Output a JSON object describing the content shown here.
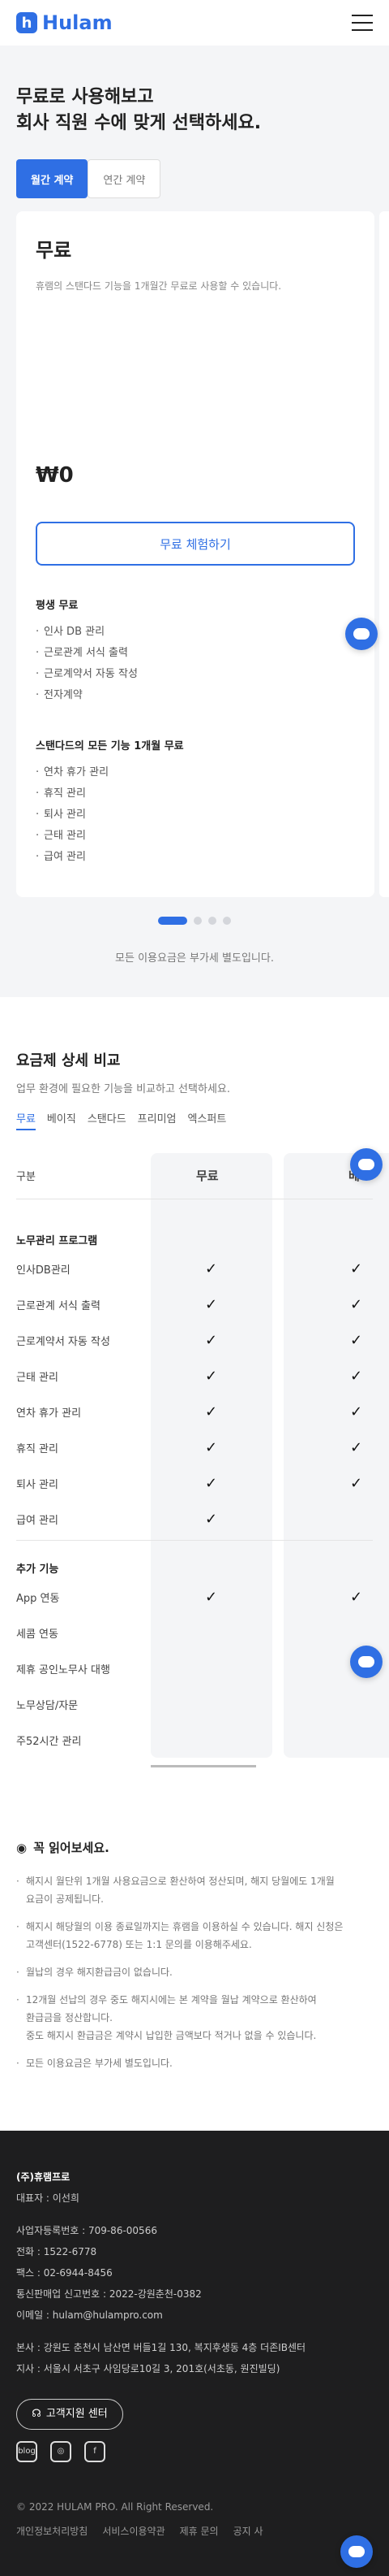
{
  "brand": {
    "logo_letter": "h",
    "name": "Hulam"
  },
  "hero": {
    "title_line1": "무료로 사용해보고",
    "title_line2": "회사 직원 수에 맞게 선택하세요.",
    "toggle_monthly": "월간 계약",
    "toggle_yearly": "연간 계약"
  },
  "plan": {
    "name": "무료",
    "description": "휴램의 스탠다드 기능을 1개월간 무료로 사용할 수 있습니다.",
    "price": "₩0",
    "cta": "무료 체험하기",
    "lifetime_title": "평생 무료",
    "lifetime_features": [
      "인사 DB 관리",
      "근로관계 서식 출력",
      "근로계약서 자동 작성",
      "전자계약"
    ],
    "trial_title": "스탠다드의 모든 기능 1개월 무료",
    "trial_features": [
      "연차 휴가 관리",
      "휴직 관리",
      "퇴사 관리",
      "근태 관리",
      "급여 관리"
    ]
  },
  "vat_note": "모든 이용요금은 부가세 별도입니다.",
  "compare": {
    "title": "요금제 상세 비교",
    "subtitle": "업무 환경에 필요한 기능을 비교하고 선택하세요.",
    "tabs": [
      "무료",
      "베이직",
      "스탠다드",
      "프리미엄",
      "엑스퍼트"
    ],
    "header_label": "구분",
    "col_free": "무료",
    "col_basic": "베",
    "check": "✓",
    "group1_title": "노무관리 프로그램",
    "group1_rows": [
      {
        "label": "인사DB관리",
        "free": true,
        "basic": true
      },
      {
        "label": "근로관계 서식 출력",
        "free": true,
        "basic": true
      },
      {
        "label": "근로계약서 자동 작성",
        "free": true,
        "basic": true
      },
      {
        "label": "근태 관리",
        "free": true,
        "basic": true
      },
      {
        "label": "연차 휴가 관리",
        "free": true,
        "basic": true
      },
      {
        "label": "휴직 관리",
        "free": true,
        "basic": true
      },
      {
        "label": "퇴사 관리",
        "free": true,
        "basic": true
      },
      {
        "label": "급여 관리",
        "free": true,
        "basic": false
      }
    ],
    "group2_title": "추가 기능",
    "group2_rows": [
      {
        "label": "App 연동",
        "free": true,
        "basic": true
      },
      {
        "label": "세콤 연동",
        "free": false,
        "basic": false
      },
      {
        "label": "제휴 공인노무사 대행",
        "free": false,
        "basic": false
      },
      {
        "label": "노무상담/자문",
        "free": false,
        "basic": false
      },
      {
        "label": "주52시간 관리",
        "free": false,
        "basic": false
      }
    ]
  },
  "notice": {
    "title": "꼭 읽어보세요.",
    "items": [
      [
        "해지시 월단위 1개월 사용요금으로 환산하여 정산되며, 해지 당월에도 1개월",
        "요금이 공제됩니다."
      ],
      [
        "해지시 해당월의 이용 종료일까지는 휴램을 이용하실 수 있습니다. 해지 신청은",
        "고객센터(1522-6778) 또는 1:1 문의를 이용해주세요."
      ],
      [
        "월납의 경우 해지환급금이 없습니다."
      ],
      [
        "12개월 선납의 경우 중도 해지시에는 본 계약을 월납 계약으로 환산하여",
        "환급금을 정산합니다.",
        "중도 해지시 환급금은 계약시 납입한 금액보다 적거나 없을 수 있습니다."
      ],
      [
        "모든 이용요금은 부가세 별도입니다."
      ]
    ]
  },
  "footer": {
    "company": "(주)휴램프로",
    "ceo": "대표자 : 이선희",
    "biz_no": "사업자등록번호 : 709-86-00566",
    "phone": "전화 : 1522-6778",
    "fax": "팩스 : 02-6944-8456",
    "ecommerce": "통신판매업 신고번호 : 2022-강원춘천-0382",
    "email": "이메일 : hulam@hulampro.com",
    "hq": "본사 : 강원도 춘천시 남산면 버들1길 130, 복지후생동 4층 더존IB센터",
    "branch": "지사 : 서울시 서초구 사임당로10길 3, 201호(서초동, 원진빌딩)",
    "support": "고객지원 센터",
    "sns_blog": "blog",
    "copyright": "© 2022 HULAM PRO. All Right Reserved.",
    "links": [
      "개인정보처리방침",
      "서비스이용약관",
      "제휴 문의",
      "공지 사"
    ]
  }
}
